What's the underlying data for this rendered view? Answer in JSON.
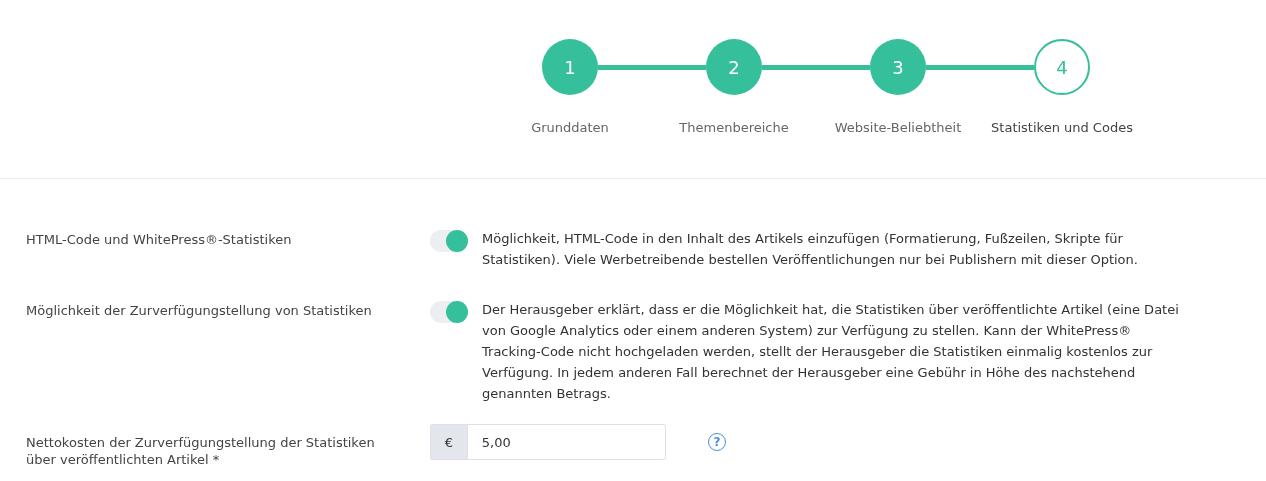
{
  "steps": [
    {
      "number": "1",
      "label": "Grunddaten",
      "completed": true
    },
    {
      "number": "2",
      "label": "Themenbereiche",
      "completed": true
    },
    {
      "number": "3",
      "label": "Website-Beliebtheit",
      "completed": true
    },
    {
      "number": "4",
      "label": "Statistiken und Codes",
      "completed": false
    }
  ],
  "settings": [
    {
      "kind": "toggle",
      "label": "HTML-Code und WhitePress®-Statistiken",
      "on": true,
      "description": "Möglichkeit, HTML-Code in den Inhalt des Artikels einzufügen (Formatierung, Fußzeilen, Skripte für Statistiken). Viele Werbetreibende bestellen Veröffentlichungen nur bei Publishern mit dieser Option."
    },
    {
      "kind": "toggle",
      "label": "Möglichkeit der Zurverfügungstellung von Statistiken",
      "on": true,
      "description": "Der Herausgeber erklärt, dass er die Möglichkeit hat, die Statistiken über veröffentlichte Artikel (eine Datei von Google Analytics oder einem anderen System) zur Verfügung zu stellen. Kann der WhitePress® Tracking-Code nicht hochgeladen werden, stellt der Herausgeber die Statistiken einmalig kostenlos zur Verfügung. In jedem anderen Fall berechnet der Herausgeber eine Gebühr in Höhe des nachstehend genannten Betrags."
    },
    {
      "kind": "price",
      "label": "Nettokosten der Zurverfügungstellung der Statistiken über veröffentlichten Artikel *",
      "currency": "€",
      "value": "5,00",
      "help": "?"
    }
  ]
}
